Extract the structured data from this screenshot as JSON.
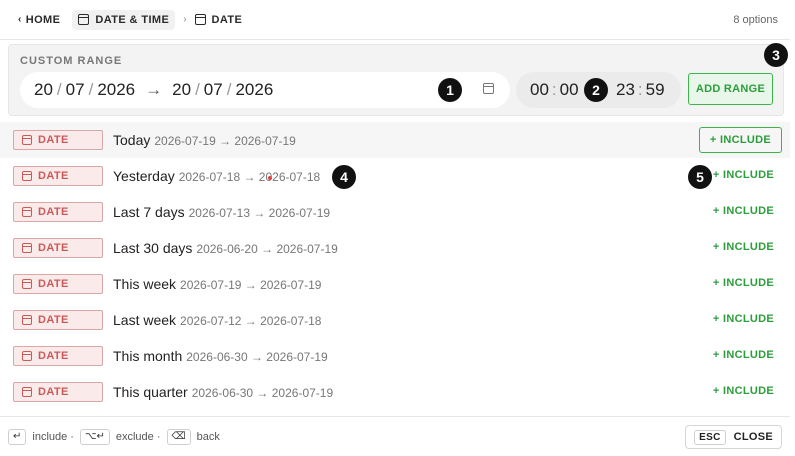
{
  "header": {
    "home": "HOME",
    "crumb1": "DATE & TIME",
    "crumb2": "DATE",
    "options": "8 options"
  },
  "custom": {
    "label": "CUSTOM RANGE",
    "from": {
      "d": "20",
      "m": "07",
      "y": "2026"
    },
    "to": {
      "d": "20",
      "m": "07",
      "y": "2026"
    },
    "arrow": "→",
    "time_from": {
      "h": "00",
      "m": "00"
    },
    "time_to": {
      "h": "23",
      "m": "59"
    },
    "add_label": "ADD RANGE"
  },
  "tag_label": "DATE",
  "include_label": "+ INCLUDE",
  "rows": [
    {
      "label": "Today",
      "range": "2026-07-19 → 2026-07-19"
    },
    {
      "label": "Yesterday",
      "range": "2026-07-18 → 2026-07-18"
    },
    {
      "label": "Last 7 days",
      "range": "2026-07-13 → 2026-07-19"
    },
    {
      "label": "Last 30 days",
      "range": "2026-06-20 → 2026-07-19"
    },
    {
      "label": "This week",
      "range": "2026-07-19 → 2026-07-19"
    },
    {
      "label": "Last week",
      "range": "2026-07-12 → 2026-07-18"
    },
    {
      "label": "This month",
      "range": "2026-06-30 → 2026-07-19"
    },
    {
      "label": "This quarter",
      "range": "2026-06-30 → 2026-07-19"
    }
  ],
  "footer": {
    "include_key": "↵",
    "include": "include ·",
    "exclude_key": "⌥↵",
    "exclude": "exclude ·",
    "back_key": "⌫",
    "back": "back",
    "esc": "ESC",
    "close": "CLOSE"
  },
  "markers": [
    "1",
    "2",
    "3",
    "4",
    "5"
  ],
  "colors": {
    "accent_green": "#3cb54a",
    "tag_red": "#c95a5a"
  }
}
